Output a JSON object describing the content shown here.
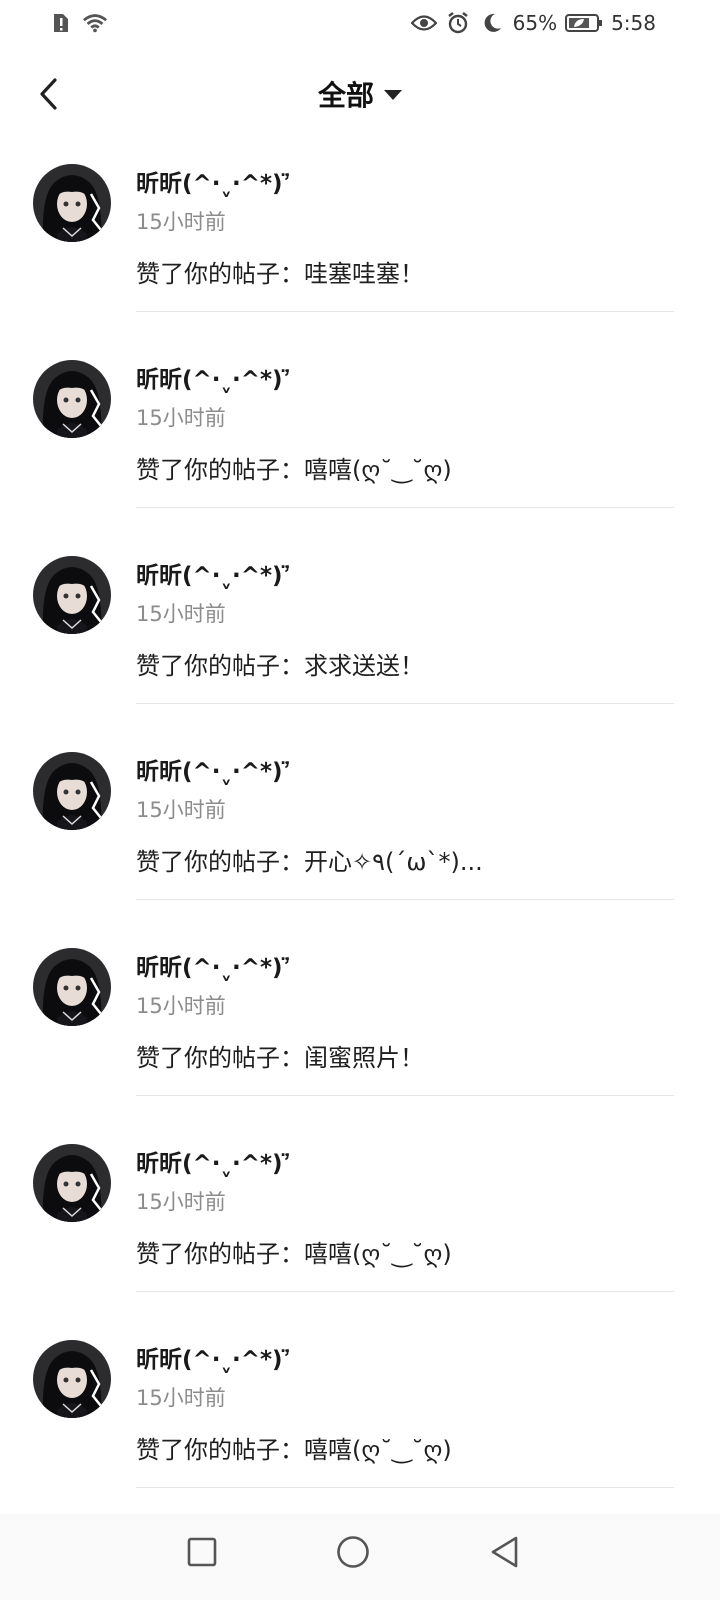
{
  "status_bar": {
    "battery_percent": "65%",
    "time": "5:58",
    "icons_left": [
      "sim-alert-icon",
      "wifi-icon"
    ],
    "icons_right": [
      "eye-comfort-icon",
      "alarm-icon",
      "moon-icon",
      "battery-icon"
    ]
  },
  "header": {
    "title": "全部",
    "back_icon": "chevron-left-icon",
    "dropdown_icon": "caret-down-icon"
  },
  "notifications": [
    {
      "name": "昕昕(^·ˬ·^*)ʾ̈",
      "time": "15小时前",
      "content": "赞了你的帖子：哇塞哇塞！"
    },
    {
      "name": "昕昕(^·ˬ·^*)ʾ̈",
      "time": "15小时前",
      "content": "赞了你的帖子：嘻嘻(ღ˘‿˘ღ)"
    },
    {
      "name": "昕昕(^·ˬ·^*)ʾ̈",
      "time": "15小时前",
      "content": "赞了你的帖子：求求送送！"
    },
    {
      "name": "昕昕(^·ˬ·^*)ʾ̈",
      "time": "15小时前",
      "content": "赞了你的帖子：开心✧٩(ˊωˋ*)..."
    },
    {
      "name": "昕昕(^·ˬ·^*)ʾ̈",
      "time": "15小时前",
      "content": "赞了你的帖子：闺蜜照片！"
    },
    {
      "name": "昕昕(^·ˬ·^*)ʾ̈",
      "time": "15小时前",
      "content": "赞了你的帖子：嘻嘻(ღ˘‿˘ღ)"
    },
    {
      "name": "昕昕(^·ˬ·^*)ʾ̈",
      "time": "15小时前",
      "content": "赞了你的帖子：嘻嘻(ღ˘‿˘ღ)"
    }
  ],
  "nav_bar": {
    "icons": [
      "recents-square-icon",
      "home-circle-icon",
      "back-triangle-icon"
    ]
  }
}
